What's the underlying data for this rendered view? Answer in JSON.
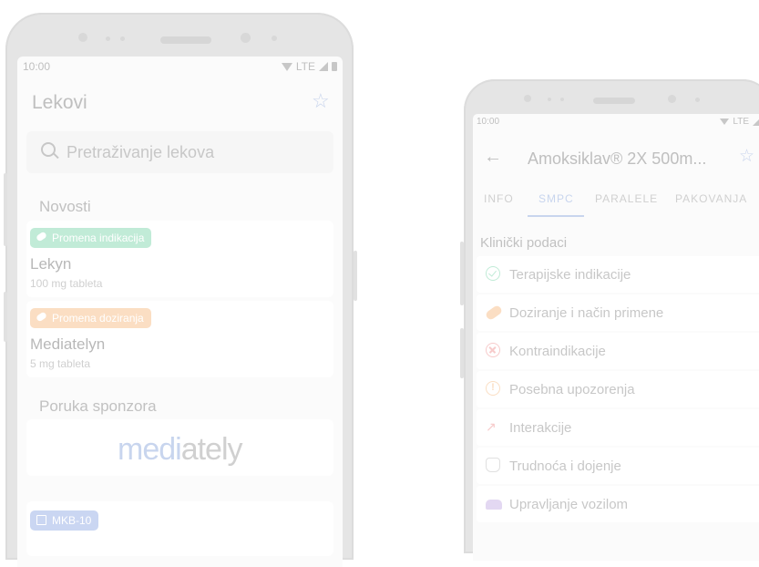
{
  "phone1": {
    "status": {
      "time": "10:00",
      "network": "LTE"
    },
    "appbar": {
      "title": "Lekovi"
    },
    "search": {
      "placeholder": "Pretraživanje lekova"
    },
    "news": {
      "title": "Novosti",
      "items": [
        {
          "badge": "Promena indikacija",
          "badge_color": "#8edbb7",
          "name": "Lekyn",
          "sub": "100 mg tableta"
        },
        {
          "badge": "Promena doziranja",
          "badge_color": "#f7c493",
          "name": "Mediatelyn",
          "sub": "5 mg tableta"
        }
      ]
    },
    "sponsor": {
      "title": "Poruka sponzora",
      "logo_part1": "medi",
      "logo_part2": "ately"
    },
    "mkb": {
      "badge": "MKB-10"
    }
  },
  "phone2": {
    "status": {
      "time": "10:00",
      "network": "LTE"
    },
    "appbar": {
      "back_icon": "arrow-left",
      "title": "Amoksiklav® 2X 500m...",
      "star_icon": "star-outline"
    },
    "tabs": [
      "INFO",
      "SMPC",
      "PARALELE",
      "PAKOVANJA"
    ],
    "active_tab": "SMPC",
    "section": "Klinički podaci",
    "items": [
      {
        "icon": "check-circle-icon",
        "label": "Terapijske indikacije"
      },
      {
        "icon": "pill-icon",
        "label": "Doziranje i način primene"
      },
      {
        "icon": "cross-circle-icon",
        "label": "Kontraindikacije"
      },
      {
        "icon": "warning-icon",
        "label": "Posebna upozorenja"
      },
      {
        "icon": "interaction-icon",
        "label": "Interakcije"
      },
      {
        "icon": "pregnancy-icon",
        "label": "Trudnoća i dojenje"
      },
      {
        "icon": "car-icon",
        "label": "Upravljanje vozilom"
      }
    ],
    "accent": "#9bb3e0"
  }
}
